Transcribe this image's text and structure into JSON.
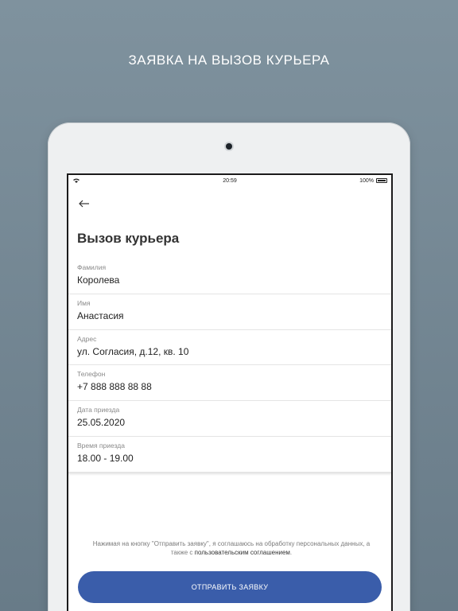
{
  "headline": "ЗАЯВКА НА ВЫЗОВ КУРЬЕРА",
  "statusbar": {
    "time": "20:59",
    "battery": "100%"
  },
  "screen": {
    "title": "Вызов курьера",
    "fields": [
      {
        "label": "Фамилия",
        "value": "Королева"
      },
      {
        "label": "Имя",
        "value": "Анастасия"
      },
      {
        "label": "Адрес",
        "value": "ул. Согласия, д.12, кв. 10"
      },
      {
        "label": "Телефон",
        "value": "+7 888 888 88 88"
      },
      {
        "label": "Дата приезда",
        "value": "25.05.2020"
      },
      {
        "label": "Время приезда",
        "value": "18.00 - 19.00"
      }
    ],
    "consent_text": "Нажимая на кнопку \"Отправить заявку\", я соглашаюсь на обработку персональных данных, а также с",
    "consent_link": "пользовательским соглашением",
    "consent_end": ".",
    "submit_label": "ОТПРАВИТЬ ЗАЯВКУ"
  },
  "colors": {
    "accent": "#3a5daa",
    "background": "#7f929e"
  }
}
